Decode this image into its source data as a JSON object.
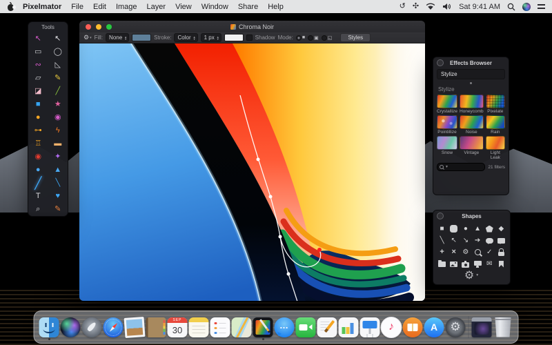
{
  "menu_bar": {
    "app_name": "Pixelmator",
    "menus": [
      "File",
      "Edit",
      "Image",
      "Layer",
      "View",
      "Window",
      "Share",
      "Help"
    ],
    "clock": "Sat 9:41 AM",
    "status_icons": [
      "time-machine-icon",
      "fan-icon",
      "wifi-icon",
      "volume-icon",
      "spotlight-icon",
      "siri-icon",
      "notification-center-icon"
    ],
    "time_machine_glyph": "↺",
    "fan_glyph": "✣"
  },
  "tools_panel": {
    "title": "Tools",
    "tools": [
      {
        "name": "move-tool",
        "glyph": "↖",
        "color": "#d45bc8"
      },
      {
        "name": "arrow-tool",
        "glyph": "↖",
        "color": "#e4e4e8"
      },
      {
        "name": "rect-marquee-tool",
        "glyph": "▭",
        "color": "#cfd0d4"
      },
      {
        "name": "ellipse-marquee-tool",
        "glyph": "◯",
        "color": "#cfd0d4"
      },
      {
        "name": "lasso-tool",
        "glyph": "∾",
        "color": "#d45bc8"
      },
      {
        "name": "polygon-lasso-tool",
        "glyph": "◺",
        "color": "#cfd0d4"
      },
      {
        "name": "transform-tool",
        "glyph": "▱",
        "color": "#cfd0d4"
      },
      {
        "name": "pencil-tool",
        "glyph": "✎",
        "color": "#e8c93e"
      },
      {
        "name": "eraser-tool",
        "glyph": "◪",
        "color": "#f0b9c8"
      },
      {
        "name": "brush-small-tool",
        "glyph": "╱",
        "color": "#8fc93e"
      },
      {
        "name": "color-fill-tool",
        "glyph": "■",
        "color": "#35a3f0"
      },
      {
        "name": "gradient-tool",
        "glyph": "★",
        "color": "#e0619f"
      },
      {
        "name": "paint-bucket-tool",
        "glyph": "●",
        "color": "#f5a623"
      },
      {
        "name": "sponge-tool",
        "glyph": "◉",
        "color": "#d45bc8"
      },
      {
        "name": "dodge-tool",
        "glyph": "⊶",
        "color": "#f5a623"
      },
      {
        "name": "burn-tool",
        "glyph": "ϟ",
        "color": "#f57a23"
      },
      {
        "name": "clone-stamp-tool",
        "glyph": "♖",
        "color": "#f5a623"
      },
      {
        "name": "healing-tool",
        "glyph": "▬",
        "color": "#f0b06a"
      },
      {
        "name": "red-eye-tool",
        "glyph": "◉",
        "color": "#e03b2f"
      },
      {
        "name": "magic-wand-tool",
        "glyph": "✦",
        "color": "#b06cf0"
      },
      {
        "name": "blur-tool",
        "glyph": "●",
        "color": "#4aa8f0"
      },
      {
        "name": "sharpen-tool",
        "glyph": "▲",
        "color": "#4aa8f0"
      },
      {
        "name": "paintbrush-tool",
        "glyph": "╱",
        "color": "#3da7f5",
        "selected": true
      },
      {
        "name": "pen-tool",
        "glyph": "╲",
        "color": "#3da7f5"
      },
      {
        "name": "type-tool",
        "glyph": "T",
        "color": "#dcdce0"
      },
      {
        "name": "shape-tool",
        "glyph": "♥",
        "color": "#3da7f5"
      },
      {
        "name": "zoom-tool",
        "glyph": "⌕",
        "color": "#cfd0d4"
      },
      {
        "name": "eyedropper-tool",
        "glyph": "✎",
        "color": "#e8803e"
      }
    ]
  },
  "window": {
    "title": "Chroma Noir",
    "toolbar": {
      "gear_glyph": "⚙",
      "fill_label": "Fill:",
      "fill_value": "None",
      "fill_swatch": "#5e7f99",
      "stroke_label": "Stroke:",
      "stroke_value": "Color",
      "stroke_width": "1 px",
      "stroke_swatch": "#f2f2f2",
      "shadow_label": "Shadow",
      "mode_label": "Mode:",
      "mode_options": [
        "shape",
        "combine",
        "subtract"
      ],
      "mode_glyphs": [
        "■",
        "▣",
        "◱"
      ],
      "styles_label": "Styles"
    }
  },
  "effects_browser": {
    "title": "Effects Browser",
    "category_value": "Stylize",
    "section_label": "Stylize",
    "effects": [
      {
        "label": "Crystallize",
        "bg": "linear-gradient(115deg,#e23b28 0%,#f0a01c 26%,#2ba24e 52%,#1d5ed2 74%,#ead44a 100%)"
      },
      {
        "label": "Honeycomb",
        "bg": "linear-gradient(100deg,#e8552a 0%,#f2b81e 30%,#36a84e 55%,#2456c8 78%,#e85a8a 100%)"
      },
      {
        "label": "Pixelate",
        "bg": "repeating-linear-gradient(0deg,rgba(0,0,0,.18) 0 2px,rgba(0,0,0,0) 2px 4px),repeating-linear-gradient(90deg,rgba(0,0,0,.18) 0 2px,rgba(0,0,0,0) 2px 4px),linear-gradient(115deg,#e23b28 0%,#f0a01c 30%,#2ba24e 58%,#1d5ed2 82%)"
      },
      {
        "label": "Pointillize",
        "bg": "radial-gradient(circle at 30% 40%,rgba(255,255,255,.55) 0 8%,rgba(0,0,0,0) 12%),radial-gradient(circle at 70% 60%,rgba(255,255,255,.4) 0 7%,rgba(0,0,0,0) 11%),linear-gradient(115deg,#d8392a 0%,#e88a2a 28%,#8a4ac8 55%,#2456c8 80%,#e8d44a 100%)"
      },
      {
        "label": "Noise",
        "bg": "linear-gradient(115deg,#e23b28 0%,#f0a01c 28%,#2ba24e 55%,#1d5ed2 78%,#ead44a 100%)"
      },
      {
        "label": "Rain",
        "bg": "linear-gradient(125deg,#e85a2a 0%,#f2c81e 30%,#2ba24e 58%,#1a4ab8 85%)"
      },
      {
        "label": "Snow",
        "bg": "linear-gradient(115deg,#7a9bd8 0%,#b48ad0 35%,#6ac8a8 65%,#d8c8e8 100%)"
      },
      {
        "label": "Vintage",
        "bg": "linear-gradient(115deg,#5a3a78 0%,#c84a88 40%,#e88a4a 75%,#e8c84a 100%)"
      },
      {
        "label": "Light Leak",
        "bg": "linear-gradient(115deg,#f5c842 0%,#f59a1a 32%,#e85a2a 62%,#f5d84a 100%)"
      }
    ],
    "filter_count": "21 filters"
  },
  "shapes_panel": {
    "title": "Shapes",
    "gear_glyph": "⚙",
    "shapes": [
      {
        "name": "square",
        "kind": "glyph",
        "glyph": "■"
      },
      {
        "name": "rounded-square",
        "kind": "rounded-square"
      },
      {
        "name": "circle",
        "kind": "glyph",
        "glyph": "●"
      },
      {
        "name": "triangle",
        "kind": "glyph",
        "glyph": "▲"
      },
      {
        "name": "pentagon",
        "kind": "pentagon"
      },
      {
        "name": "diamond",
        "kind": "glyph",
        "glyph": "◆"
      },
      {
        "name": "line",
        "kind": "glyph",
        "glyph": "╲"
      },
      {
        "name": "arrow-diagonal-up",
        "kind": "glyph",
        "glyph": "↖"
      },
      {
        "name": "arrow-diagonal-down",
        "kind": "glyph",
        "glyph": "↘"
      },
      {
        "name": "arrow-right",
        "kind": "glyph",
        "glyph": "➔"
      },
      {
        "name": "speech-bubble-round",
        "kind": "bubble-round"
      },
      {
        "name": "speech-bubble-square",
        "kind": "bubble-square"
      },
      {
        "name": "plus",
        "kind": "glyph-bold",
        "glyph": "+"
      },
      {
        "name": "cross",
        "kind": "glyph-bold",
        "glyph": "×"
      },
      {
        "name": "gear",
        "kind": "glyph",
        "glyph": "⚙"
      },
      {
        "name": "magnifier",
        "kind": "magnifier"
      },
      {
        "name": "checkmark",
        "kind": "glyph",
        "glyph": "✓"
      },
      {
        "name": "lock",
        "kind": "lock"
      },
      {
        "name": "folder",
        "kind": "folder"
      },
      {
        "name": "image",
        "kind": "image"
      },
      {
        "name": "camera",
        "kind": "camera"
      },
      {
        "name": "monitor",
        "kind": "monitor"
      },
      {
        "name": "envelope",
        "kind": "glyph",
        "glyph": "✉"
      },
      {
        "name": "bookmark",
        "kind": "bookmark"
      }
    ]
  },
  "dock": {
    "items": [
      {
        "name": "finder",
        "running": true
      },
      {
        "name": "siri"
      },
      {
        "name": "launchpad"
      },
      {
        "name": "safari"
      },
      {
        "name": "preview"
      },
      {
        "name": "contacts"
      },
      {
        "name": "calendar",
        "month": "SEP",
        "day": "30"
      },
      {
        "name": "notes"
      },
      {
        "name": "reminders"
      },
      {
        "name": "maps"
      },
      {
        "name": "pixelmator",
        "running": true
      },
      {
        "name": "messages",
        "glyph": "…"
      },
      {
        "name": "facetime"
      },
      {
        "name": "pages"
      },
      {
        "name": "numbers"
      },
      {
        "name": "keynote"
      },
      {
        "name": "itunes",
        "glyph": "♪"
      },
      {
        "name": "ibooks"
      },
      {
        "name": "appstore",
        "glyph": "A"
      },
      {
        "name": "sysprefs",
        "glyph": "⚙"
      },
      {
        "type": "separator"
      },
      {
        "name": "minwindow"
      },
      {
        "name": "trash"
      }
    ]
  }
}
